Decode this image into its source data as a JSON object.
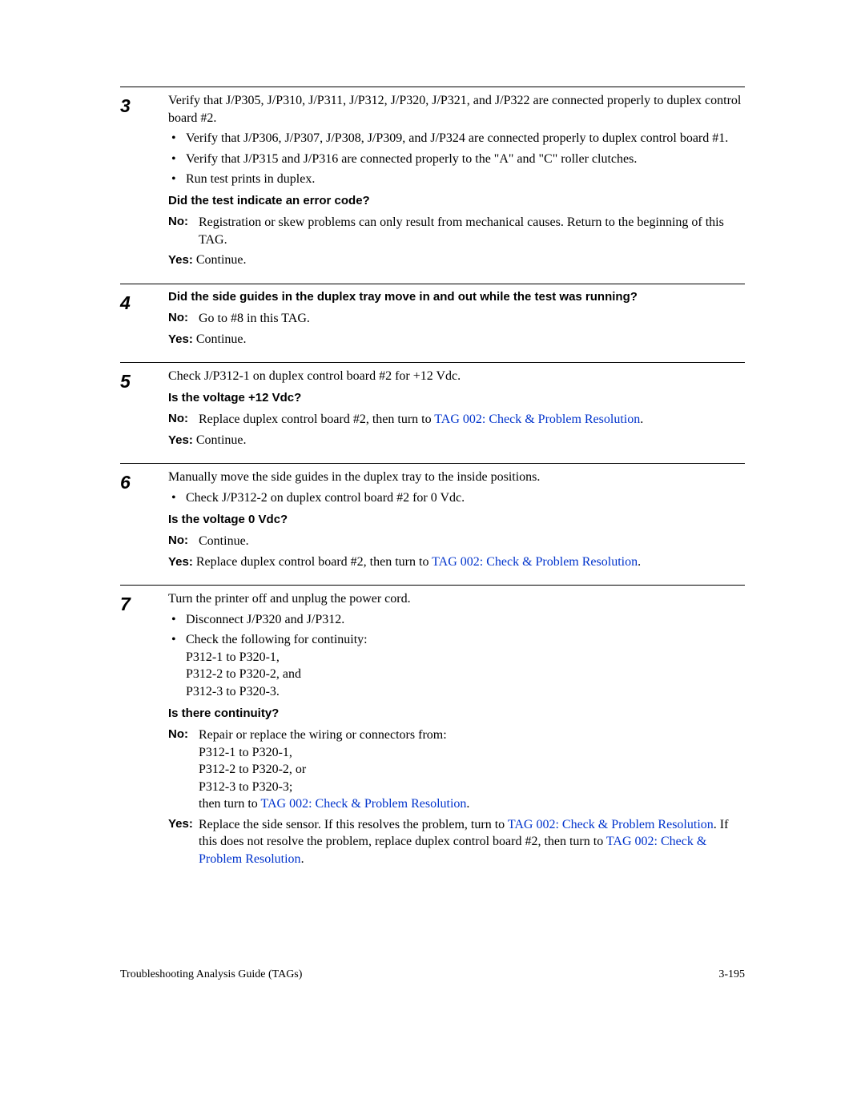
{
  "steps": {
    "s3": {
      "num": "3",
      "intro": "Verify that J/P305, J/P310, J/P311, J/P312, J/P320, J/P321, and J/P322 are connected properly to duplex control board #2.",
      "b1": "Verify that J/P306, J/P307, J/P308, J/P309, and J/P324 are connected properly to duplex control board #1.",
      "b2": "Verify that J/P315 and J/P316 are connected properly to the \"A\" and \"C\" roller clutches.",
      "b3": "Run test prints in duplex.",
      "q": "Did the test indicate an error code?",
      "no_label": "No:",
      "no_text": "Registration or skew problems can only result from mechanical causes. Return to the beginning of this TAG.",
      "yes_label": "Yes:",
      "yes_text": "Continue."
    },
    "s4": {
      "num": "4",
      "q": "Did the side guides in the duplex tray move in and out while the test was running?",
      "no_label": "No:",
      "no_text": "Go to #8 in this TAG.",
      "yes_label": "Yes:",
      "yes_text": "Continue."
    },
    "s5": {
      "num": "5",
      "intro": "Check J/P312-1 on duplex control board #2 for +12 Vdc.",
      "q": "Is the voltage +12 Vdc?",
      "no_label": "No:",
      "no_text_a": "Replace duplex control board #2, then turn to ",
      "no_link": "TAG 002: Check & Problem Resolution",
      "no_text_b": ".",
      "yes_label": "Yes:",
      "yes_text": "Continue."
    },
    "s6": {
      "num": "6",
      "intro": "Manually move the side guides in the duplex tray to the inside positions.",
      "b1": "Check J/P312-2 on duplex control board #2 for 0 Vdc.",
      "q": "Is the voltage 0 Vdc?",
      "no_label": "No:",
      "no_text": "Continue.",
      "yes_label": "Yes:",
      "yes_text_a": "Replace duplex control board #2, then turn to ",
      "yes_link": "TAG 002: Check & Problem Resolution",
      "yes_text_b": "."
    },
    "s7": {
      "num": "7",
      "intro": "Turn the printer off and unplug the power cord.",
      "b1": "Disconnect J/P320 and J/P312.",
      "b2a": "Check the following for continuity:",
      "b2b": "P312-1 to P320-1,",
      "b2c": "P312-2 to P320-2, and",
      "b2d": "P312-3 to P320-3.",
      "q": "Is there continuity?",
      "no_label": "No:",
      "no_text_a": "Repair or replace the wiring or connectors from:",
      "no_text_b": "P312-1 to P320-1,",
      "no_text_c": "P312-2 to P320-2, or",
      "no_text_d": "P312-3 to P320-3;",
      "no_text_e": "then turn to ",
      "no_link": "TAG 002: Check & Problem Resolution",
      "no_text_f": ".",
      "yes_label": "Yes:",
      "yes_text_a": "Replace the side sensor. If this resolves the problem, turn to ",
      "yes_link1": "TAG 002: Check & Problem Resolution",
      "yes_text_b": ". If this does not resolve the problem, replace duplex control board #2, then turn to ",
      "yes_link2": "TAG 002: Check & Problem Resolution",
      "yes_text_c": "."
    }
  },
  "footer": {
    "left": "Troubleshooting Analysis Guide (TAGs)",
    "right": "3-195"
  }
}
